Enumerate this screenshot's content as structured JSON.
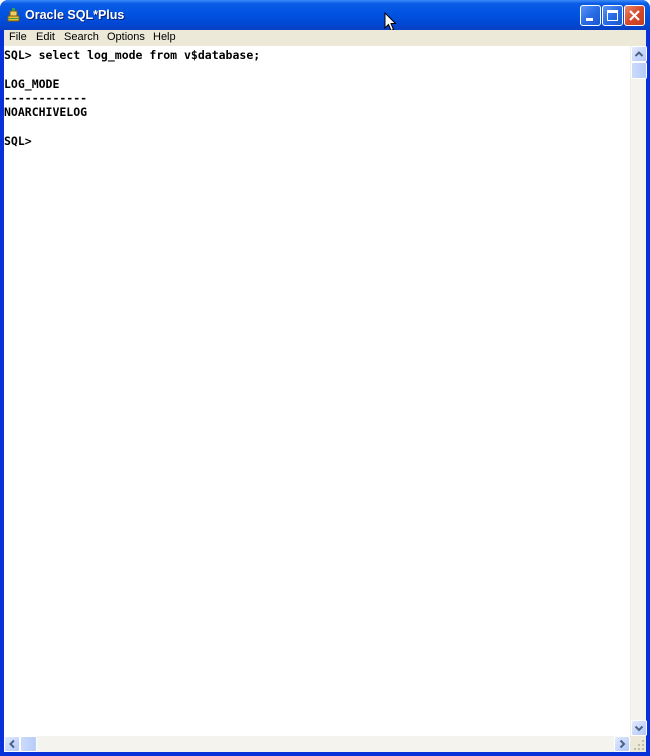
{
  "window": {
    "title": "Oracle SQL*Plus",
    "title_icon": "oracle-sqlplus-icon",
    "caption_buttons": [
      "minimize",
      "maximize",
      "close"
    ]
  },
  "menu": {
    "items": [
      "File",
      "Edit",
      "Search",
      "Options",
      "Help"
    ]
  },
  "console": {
    "lines": [
      "SQL> select log_mode from v$database;",
      "",
      "LOG_MODE",
      "------------",
      "NOARCHIVELOG",
      "",
      "SQL>"
    ]
  },
  "colors": {
    "titlebar": "#0054e3",
    "close_button": "#d6492a",
    "menubar": "#ece9d8",
    "console_background": "#ffffff",
    "console_text": "#000000"
  }
}
